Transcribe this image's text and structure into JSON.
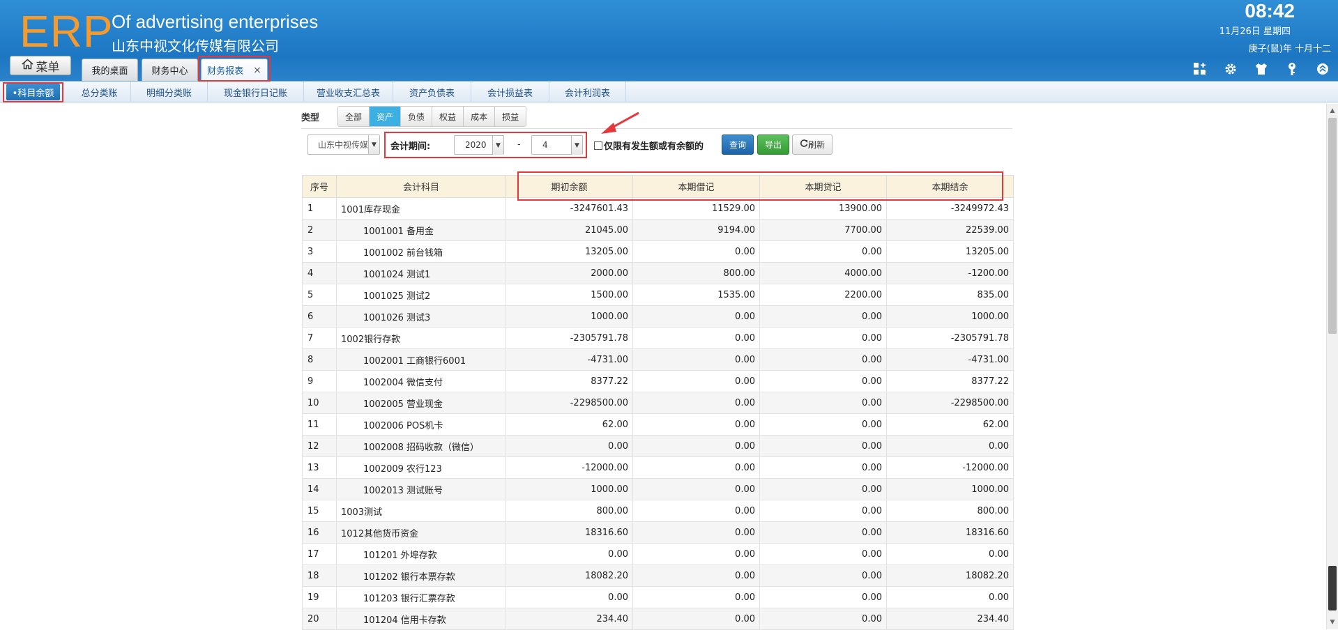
{
  "header": {
    "logo": "ERP",
    "company_en": "Of advertising enterprises",
    "company_cn": "山东中视文化传媒有限公司",
    "time": "08:42",
    "date": "11月26日 星期四",
    "lunar": "庚子(鼠)年 十月十二",
    "menu_label": "菜单",
    "tabs": [
      {
        "label": "我的桌面"
      },
      {
        "label": "财务中心"
      },
      {
        "label": "财务报表",
        "close": "×"
      }
    ]
  },
  "subnav": {
    "items": [
      "•科目余额",
      "总分类账",
      "明细分类账",
      "现金银行日记账",
      "营业收支汇总表",
      "资产负债表",
      "会计损益表",
      "会计利润表"
    ]
  },
  "filters": {
    "type_label": "类型",
    "types": [
      "全部",
      "资产",
      "负债",
      "权益",
      "成本",
      "损益"
    ],
    "active_type": "资产",
    "company": "山东中视传媒",
    "period_label": "会计期间:",
    "year": "2020",
    "dash": "-",
    "month": "4",
    "only_label": "仅限有发生额或有余额的",
    "query_label": "查询",
    "export_label": "导出",
    "refresh_label": "刷新"
  },
  "table": {
    "headers": [
      "序号",
      "会计科目",
      "期初余额",
      "本期借记",
      "本期贷记",
      "本期结余"
    ],
    "rows": [
      {
        "no": "1",
        "subject": "1001库存现金",
        "level": 0,
        "opening": "-3247601.43",
        "debit": "11529.00",
        "credit": "13900.00",
        "closing": "-3249972.43"
      },
      {
        "no": "2",
        "subject": "1001001 备用金",
        "level": 1,
        "opening": "21045.00",
        "debit": "9194.00",
        "credit": "7700.00",
        "closing": "22539.00"
      },
      {
        "no": "3",
        "subject": "1001002 前台钱箱",
        "level": 1,
        "opening": "13205.00",
        "debit": "0.00",
        "credit": "0.00",
        "closing": "13205.00"
      },
      {
        "no": "4",
        "subject": "1001024 测试1",
        "level": 1,
        "opening": "2000.00",
        "debit": "800.00",
        "credit": "4000.00",
        "closing": "-1200.00"
      },
      {
        "no": "5",
        "subject": "1001025 测试2",
        "level": 1,
        "opening": "1500.00",
        "debit": "1535.00",
        "credit": "2200.00",
        "closing": "835.00"
      },
      {
        "no": "6",
        "subject": "1001026 测试3",
        "level": 1,
        "opening": "1000.00",
        "debit": "0.00",
        "credit": "0.00",
        "closing": "1000.00"
      },
      {
        "no": "7",
        "subject": "1002银行存款",
        "level": 0,
        "opening": "-2305791.78",
        "debit": "0.00",
        "credit": "0.00",
        "closing": "-2305791.78"
      },
      {
        "no": "8",
        "subject": "1002001 工商银行6001",
        "level": 1,
        "opening": "-4731.00",
        "debit": "0.00",
        "credit": "0.00",
        "closing": "-4731.00"
      },
      {
        "no": "9",
        "subject": "1002004 微信支付",
        "level": 1,
        "opening": "8377.22",
        "debit": "0.00",
        "credit": "0.00",
        "closing": "8377.22"
      },
      {
        "no": "10",
        "subject": "1002005 营业现金",
        "level": 1,
        "opening": "-2298500.00",
        "debit": "0.00",
        "credit": "0.00",
        "closing": "-2298500.00"
      },
      {
        "no": "11",
        "subject": "1002006 POS机卡",
        "level": 1,
        "opening": "62.00",
        "debit": "0.00",
        "credit": "0.00",
        "closing": "62.00"
      },
      {
        "no": "12",
        "subject": "1002008 招码收款（微信）",
        "level": 1,
        "opening": "0.00",
        "debit": "0.00",
        "credit": "0.00",
        "closing": "0.00"
      },
      {
        "no": "13",
        "subject": "1002009 农行123",
        "level": 1,
        "opening": "-12000.00",
        "debit": "0.00",
        "credit": "0.00",
        "closing": "-12000.00"
      },
      {
        "no": "14",
        "subject": "1002013 测试账号",
        "level": 1,
        "opening": "1000.00",
        "debit": "0.00",
        "credit": "0.00",
        "closing": "1000.00"
      },
      {
        "no": "15",
        "subject": "1003测试",
        "level": 0,
        "opening": "800.00",
        "debit": "0.00",
        "credit": "0.00",
        "closing": "800.00"
      },
      {
        "no": "16",
        "subject": "1012其他货币资金",
        "level": 0,
        "opening": "18316.60",
        "debit": "0.00",
        "credit": "0.00",
        "closing": "18316.60"
      },
      {
        "no": "17",
        "subject": "101201 外埠存款",
        "level": 1,
        "opening": "0.00",
        "debit": "0.00",
        "credit": "0.00",
        "closing": "0.00"
      },
      {
        "no": "18",
        "subject": "101202 银行本票存款",
        "level": 1,
        "opening": "18082.20",
        "debit": "0.00",
        "credit": "0.00",
        "closing": "18082.20"
      },
      {
        "no": "19",
        "subject": "101203 银行汇票存款",
        "level": 1,
        "opening": "0.00",
        "debit": "0.00",
        "credit": "0.00",
        "closing": "0.00"
      },
      {
        "no": "20",
        "subject": "101204 信用卡存款",
        "level": 1,
        "opening": "234.40",
        "debit": "0.00",
        "credit": "0.00",
        "closing": "234.40"
      }
    ]
  },
  "icons": {
    "menu": "home-icon",
    "tools": [
      "add-widget-icon",
      "gear-icon",
      "skin-icon",
      "key-icon",
      "collapse-icon"
    ],
    "refresh": "refresh-icon",
    "dropdown": "chevron-down-icon"
  },
  "colors": {
    "header_blue": "#1d76c2",
    "logo_orange": "#f59a2c",
    "active_type": "#3cb0e2",
    "table_header": "#fbf2de",
    "highlight_red": "#e5383b",
    "query_blue": "#1e62a8",
    "export_green": "#369c36"
  }
}
